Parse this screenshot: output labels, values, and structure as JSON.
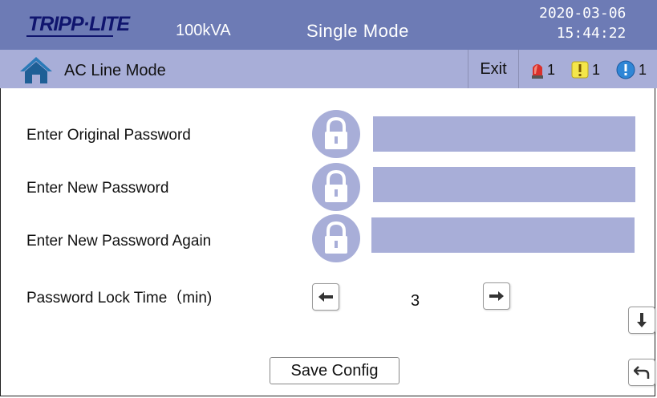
{
  "header": {
    "logo_text": "TRIPP·LITE",
    "capacity": "100kVA",
    "mode": "Single Mode",
    "date": "2020-03-06",
    "time": "15:44:22"
  },
  "subheader": {
    "title": "AC Line Mode",
    "exit_label": "Exit",
    "alarms": [
      {
        "type": "alarm-light-icon",
        "count": "1"
      },
      {
        "type": "warning-icon",
        "count": "1"
      },
      {
        "type": "info-icon",
        "count": "1"
      }
    ]
  },
  "form": {
    "original_password_label": "Enter Original Password",
    "new_password_label": "Enter New Password",
    "new_password_again_label": "Enter New Password Again",
    "lock_time_label": "Password Lock Time（min)",
    "lock_time_value": "3",
    "save_label": "Save Config",
    "original_password_value": "",
    "new_password_value": "",
    "new_password_again_value": ""
  },
  "colors": {
    "topbar": "#6d7bb5",
    "subbar": "#a8aed8",
    "logo": "#10156e",
    "field": "#a8aed8",
    "lock_icon": "#a8aed8"
  }
}
